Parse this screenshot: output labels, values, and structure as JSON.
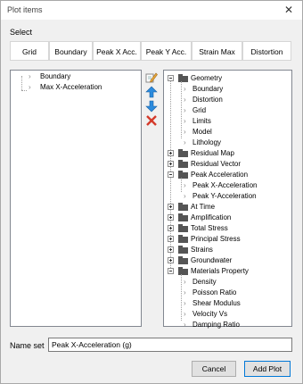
{
  "window": {
    "title": "Plot items",
    "close_glyph": "✕"
  },
  "select": {
    "label": "Select",
    "buttons": [
      "Grid",
      "Boundary",
      "Peak X Acc.",
      "Peak Y Acc.",
      "Strain Max",
      "Distortion"
    ]
  },
  "selected_items": [
    "Boundary",
    "Max X-Acceleration"
  ],
  "tools": {
    "edit_icon": "pencil-edit-icon",
    "up_icon": "arrow-up-icon",
    "down_icon": "arrow-down-icon",
    "delete_icon": "delete-x-icon"
  },
  "tree": {
    "geometry": {
      "label": "Geometry",
      "children": [
        "Boundary",
        "Distortion",
        "Grid",
        "Limits",
        "Model",
        "Lithology"
      ]
    },
    "residual_map": "Residual Map",
    "residual_vector": "Residual Vector",
    "peak_acceleration": {
      "label": "Peak Acceleration",
      "children": [
        "Peak X-Acceleration",
        "Peak Y-Acceleration"
      ]
    },
    "at_time": "At Time",
    "amplification": "Amplification",
    "total_stress": "Total Stress",
    "principal_stress": "Principal Stress",
    "strains": "Strains",
    "groundwater": "Groundwater",
    "materials": {
      "label": "Materials Property",
      "children": [
        "Density",
        "Poisson Ratio",
        "Shear Modulus",
        "Velocity Vs",
        "Damping Ratio"
      ]
    }
  },
  "name_set": {
    "label": "Name set",
    "value": "Peak X-Acceleration (g)"
  },
  "footer": {
    "cancel": "Cancel",
    "add_plot": "Add Plot"
  }
}
